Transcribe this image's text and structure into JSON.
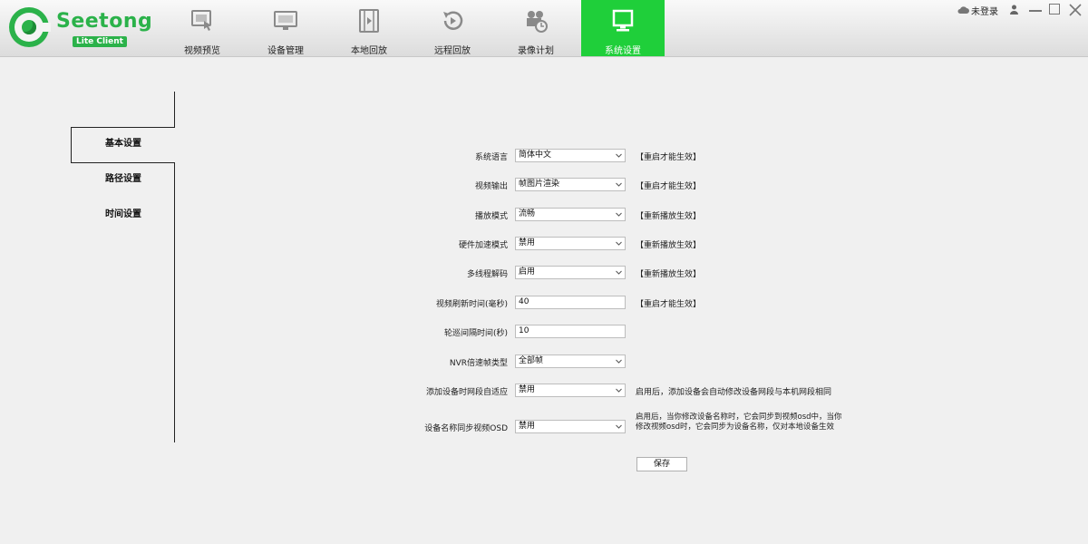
{
  "app": {
    "brand_name": "Seetong",
    "brand_sub": "Lite Client",
    "brand_color": "#2bb24a",
    "active_color": "#1fcf3a"
  },
  "nav": {
    "items": [
      {
        "label": "视频预览",
        "icon": "monitor-touch-icon"
      },
      {
        "label": "设备管理",
        "icon": "device-monitor-icon"
      },
      {
        "label": "本地回放",
        "icon": "film-icon"
      },
      {
        "label": "远程回放",
        "icon": "replay-icon"
      },
      {
        "label": "录像计划",
        "icon": "camera-schedule-icon"
      },
      {
        "label": "系统设置",
        "icon": "settings-monitor-icon",
        "active": true
      }
    ]
  },
  "window": {
    "login_label": "未登录"
  },
  "side": {
    "tabs": [
      {
        "label": "基本设置",
        "active": true
      },
      {
        "label": "路径设置"
      },
      {
        "label": "时间设置"
      }
    ]
  },
  "form": {
    "rows": [
      {
        "label": "系统语言",
        "value": "简体中文",
        "type": "select",
        "note": "【重启才能生效】"
      },
      {
        "label": "视频输出",
        "value": "帧图片渲染",
        "type": "select",
        "note": "【重启才能生效】"
      },
      {
        "label": "播放模式",
        "value": "流畅",
        "type": "select",
        "note": "【重新播放生效】"
      },
      {
        "label": "硬件加速模式",
        "value": "禁用",
        "type": "select",
        "note": "【重新播放生效】"
      },
      {
        "label": "多线程解码",
        "value": "启用",
        "type": "select",
        "note": "【重新播放生效】"
      },
      {
        "label": "视频刷新时间(毫秒)",
        "value": "40",
        "type": "input",
        "note": "【重启才能生效】"
      },
      {
        "label": "轮巡间隔时间(秒)",
        "value": "10",
        "type": "input",
        "note": ""
      },
      {
        "label": "NVR倍速帧类型",
        "value": "全部帧",
        "type": "select",
        "note": ""
      },
      {
        "label": "添加设备时网段自适应",
        "value": "禁用",
        "type": "select",
        "note": "启用后，添加设备会自动修改设备网段与本机网段相同"
      },
      {
        "label": "设备名称同步视频OSD",
        "value": "禁用",
        "type": "select",
        "note": "启用后，当你修改设备名称时，它会同步到视频osd中，当你修改视频osd时，它会同步为设备名称，仅对本地设备生效"
      }
    ],
    "save_label": "保存"
  }
}
